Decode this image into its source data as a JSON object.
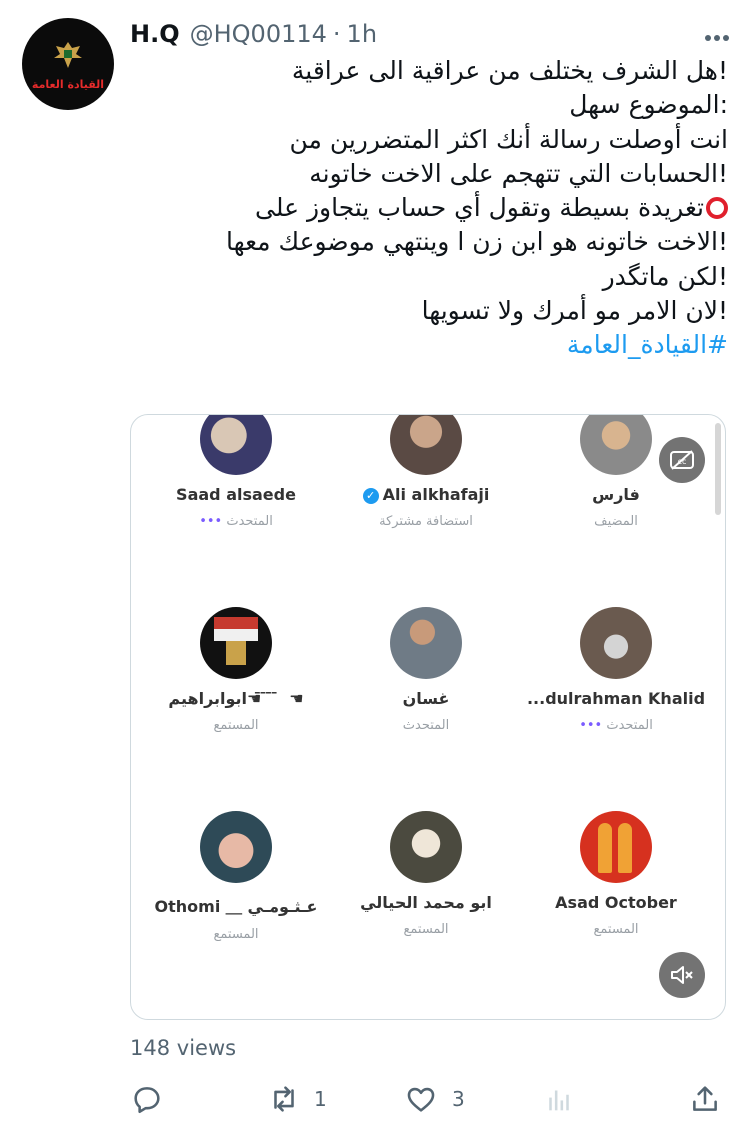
{
  "author": {
    "display_name": "H.Q",
    "handle": "@HQ00114",
    "separator": "·",
    "time": "1h",
    "avatar_label": "القيادة العامة"
  },
  "tweet": {
    "lines": [
      "!هل الشرف يختلف من عراقية الى عراقية",
      ":الموضوع سهل",
      "انت أوصلت رسالة أنك اكثر المتضررين من",
      "!الحسابات التي تتهجم على الاخت خاتونه",
      "تغريدة بسيطة وتقول أي حساب يتجاوز على",
      "!الاخت خاتونه هو ابن زن ا وينتهي موضوعك معها",
      "!لكن ماتگدر",
      "!لان الامر مو أمرك ولا تسويها"
    ],
    "hashtag": "#القيادة_العامة"
  },
  "media": {
    "participants": [
      {
        "name": "Saad alsaede",
        "role": "المتحدث",
        "dots": "•••"
      },
      {
        "name": "Ali alkhafaji",
        "role": "استضافة مشتركة",
        "verified": true
      },
      {
        "name": "فارس",
        "role": "المضيف"
      },
      {
        "name": "ابوابراهيم☚ ̄ ̄ ̄ ̄ ☚",
        "role": "المستمع"
      },
      {
        "name": "غسان",
        "role": "المتحدث"
      },
      {
        "name": "...dulrahman Khalid",
        "role": "المتحدث",
        "dots": "•••"
      },
      {
        "name": "Othomi ＿ عـثـومـي",
        "role": "المستمع"
      },
      {
        "name": "ابو محمد الحيالي",
        "role": "المستمع"
      },
      {
        "name": "Asad October",
        "role": "المستمع"
      }
    ],
    "captions_icon": "captions-off-icon",
    "mute_icon": "volume-muted-icon"
  },
  "stats": {
    "views_count": "148",
    "views_label": " views"
  },
  "actions": {
    "reply_count": "",
    "retweet_count": "1",
    "like_count": "3"
  },
  "colors": {
    "accent": "#1d9bf0",
    "text": "#0f1419",
    "muted": "#536471",
    "red_circle": "#e0202d"
  }
}
